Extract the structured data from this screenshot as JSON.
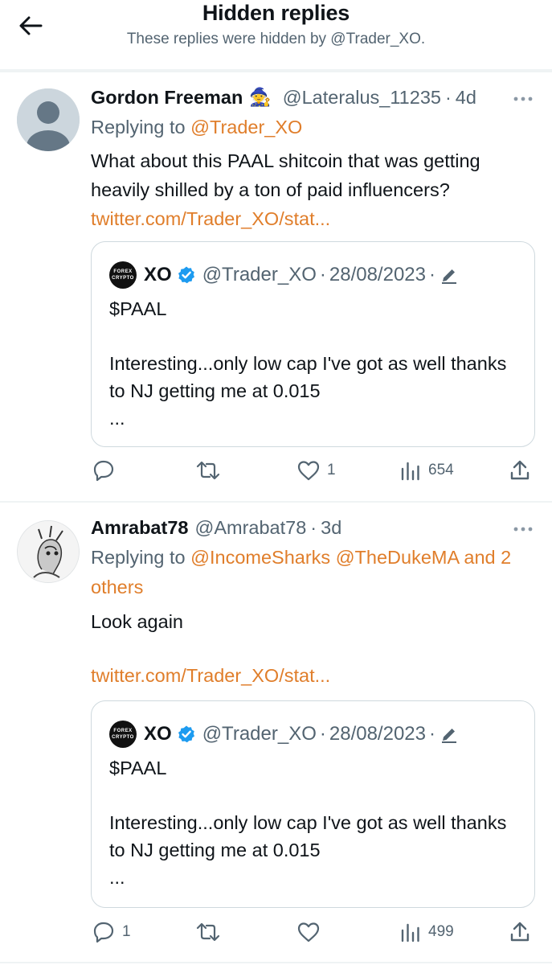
{
  "header": {
    "title": "Hidden replies",
    "subtitle": "These replies were hidden by @Trader_XO."
  },
  "tweets": [
    {
      "display_name": "Gordon Freeman",
      "name_emoji": "🧙",
      "handle": "@Lateralus_11235",
      "separator": "·",
      "time": "4d",
      "replying_prefix": "Replying to",
      "replying_to": [
        "@Trader_XO"
      ],
      "replying_extra": "",
      "text": "What about this PAAL shitcoin that was getting heavily shilled by a ton of paid influencers?",
      "link": "twitter.com/Trader_XO/stat...",
      "quote": {
        "avatar_text_1": "FOREX",
        "avatar_text_2": "CRYPTO",
        "name": "XO",
        "handle": "@Trader_XO",
        "separator": "·",
        "date": "28/08/2023",
        "text": "$PAAL\n\nInteresting...only low cap I've got as well thanks to NJ getting me at 0.015\n..."
      },
      "actions": {
        "replies": "",
        "retweets": "",
        "likes": "1",
        "views": "654"
      }
    },
    {
      "display_name": "Amrabat78",
      "handle": "@Amrabat78",
      "separator": "·",
      "time": "3d",
      "replying_prefix": "Replying to",
      "replying_to": [
        "@IncomeSharks",
        "@TheDukeMA"
      ],
      "replying_extra": "and 2 others",
      "text": "Look again",
      "link": "twitter.com/Trader_XO/stat...",
      "quote": {
        "avatar_text_1": "FOREX",
        "avatar_text_2": "CRYPTO",
        "name": "XO",
        "handle": "@Trader_XO",
        "separator": "·",
        "date": "28/08/2023",
        "text": "$PAAL\n\nInteresting...only low cap I've got as well thanks to NJ getting me at 0.015\n..."
      },
      "actions": {
        "replies": "1",
        "retweets": "",
        "likes": "",
        "views": "499"
      }
    }
  ],
  "colors": {
    "mention": "#e07e2b",
    "secondary_text": "#536471",
    "verified": "#1d9bf0",
    "border": "#cfd9de"
  },
  "icons": [
    "back-arrow-icon",
    "more-icon",
    "verified-badge-icon",
    "edit-pencil-icon",
    "reply-icon",
    "retweet-icon",
    "like-icon",
    "views-icon",
    "share-icon"
  ]
}
